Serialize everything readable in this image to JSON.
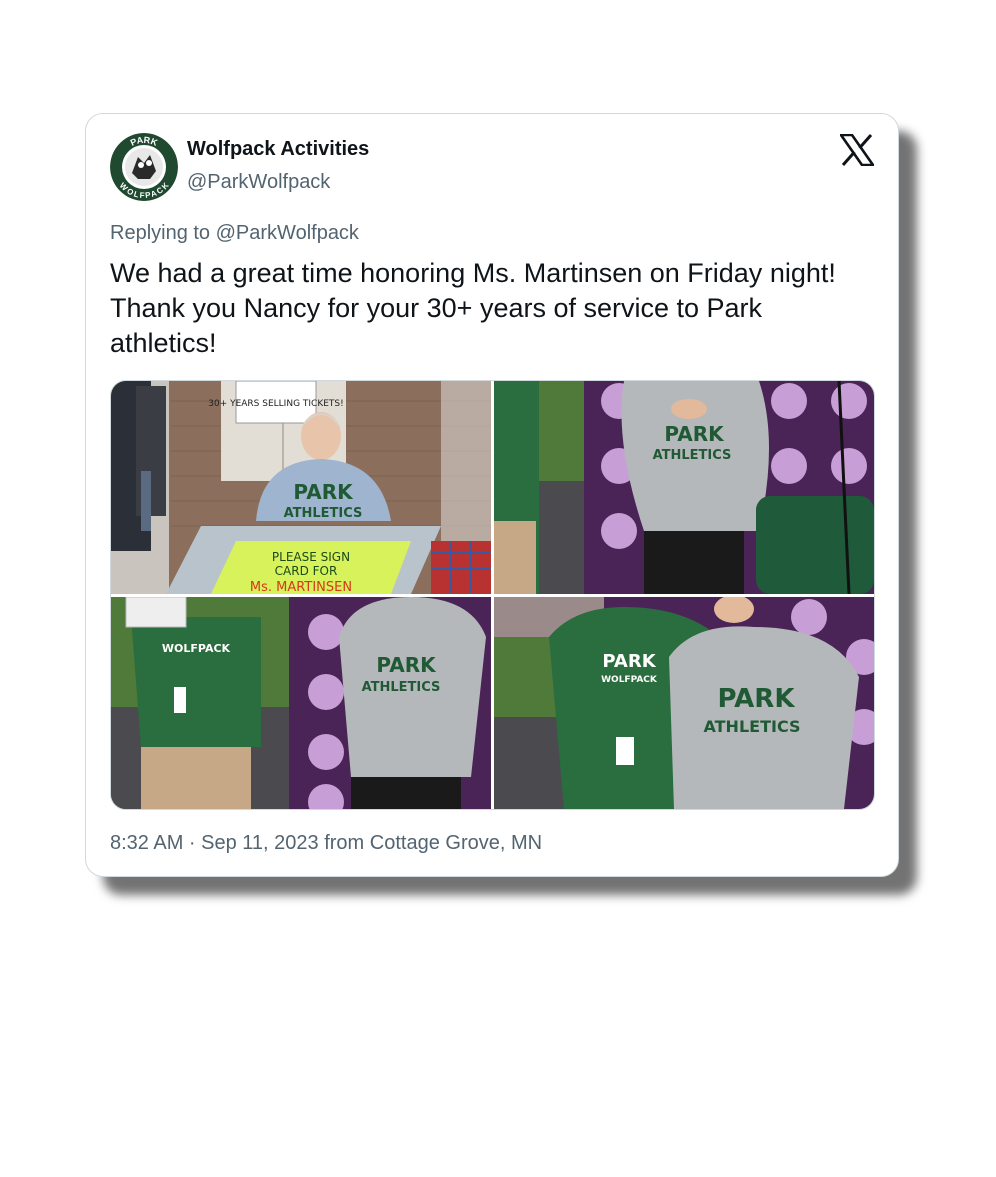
{
  "tweet": {
    "display_name": "Wolfpack Activities",
    "handle": "@ParkWolfpack",
    "avatar_text_top": "PARK",
    "avatar_text_bottom": "WOLFPACK",
    "reply_prefix": "Replying to",
    "reply_handle": "@ParkWolfpack",
    "text": "We had a great time honoring Ms. Martinsen on Friday night! Thank you Nancy for your 30+ years of service to Park athletics!",
    "timestamp": "8:32 AM · Sep 11, 2023 from Cottage Grove, MN",
    "platform_icon": "x-logo-icon"
  },
  "photos": [
    {
      "sign_top": "30+ YEARS SELLING TICKETS!",
      "shirt_line1": "PARK",
      "shirt_line2": "ATHLETICS",
      "poster_line1": "PLEASE SIGN",
      "poster_line2": "CARD FOR",
      "poster_line3": "Ms. MARTINSEN"
    },
    {
      "shirt_line1": "PARK",
      "shirt_line2": "ATHLETICS"
    },
    {
      "shirt_line1": "PARK",
      "shirt_line2": "ATHLETICS",
      "green_shirt": "WOLFPACK"
    },
    {
      "shirt_line1": "PARK",
      "shirt_line2": "ATHLETICS",
      "green_shirt_line1": "PARK",
      "green_shirt_line2": "WOLFPACK"
    }
  ],
  "colors": {
    "text_primary": "#0f1419",
    "text_secondary": "#536471",
    "border": "#cfd9de",
    "team_green": "#1f5a35",
    "backdrop_purple": "#4a2456"
  }
}
